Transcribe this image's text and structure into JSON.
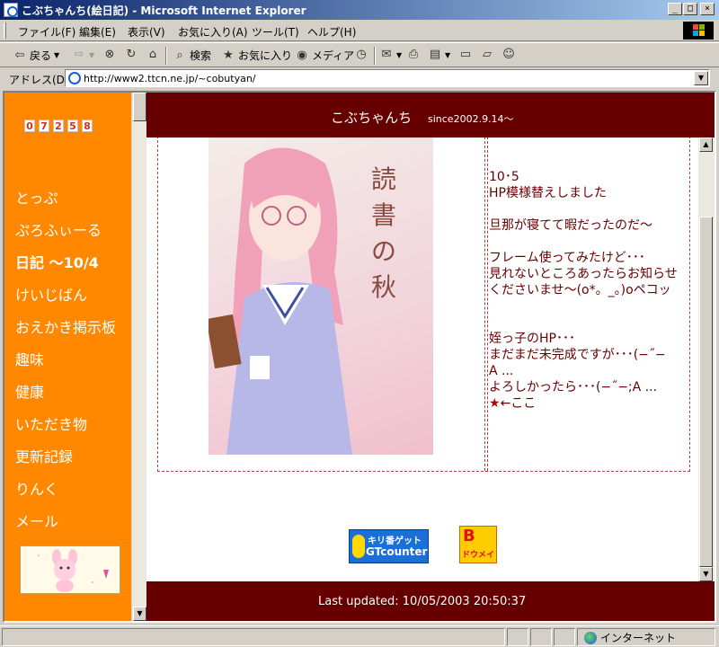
{
  "window": {
    "title": "こぶちゃんち(絵日記) - Microsoft Internet Explorer",
    "min_glyph": "_",
    "max_glyph": "□",
    "close_glyph": "×"
  },
  "menu": [
    "ファイル(F)",
    "編集(E)",
    "表示(V)",
    "お気に入り(A)",
    "ツール(T)",
    "ヘルプ(H)"
  ],
  "toolbar": {
    "back": "戻る",
    "search": "検索",
    "favorites": "お気に入り",
    "media": "メディア"
  },
  "address": {
    "label": "アドレス(D)",
    "url": "http://www2.ttcn.ne.jp/~cobutyan/"
  },
  "sidebar": {
    "counter_digits": [
      "0",
      "7",
      "2",
      "5",
      "8"
    ],
    "links": [
      "とっぷ",
      "ぷろふぃーる",
      "日記 〜10/4",
      "けいじばん",
      "おえかき掲示板",
      "趣味",
      "健康",
      "いただき物",
      "更新記録",
      "りんく",
      "メール"
    ]
  },
  "header": {
    "site_name": "こぶちゃんち",
    "since": "since2002.9.14〜"
  },
  "artwork": {
    "caption_line1": "読書の",
    "caption_line2": "秋"
  },
  "news": {
    "lines": [
      "10･5",
      "HP模様替えしました",
      "",
      "旦那が寝てて暇だったのだ〜",
      "",
      "フレーム使ってみたけど･･･",
      "見れないところあったらお知らせ",
      "くださいませ〜(o*。_。)oペコッ",
      "",
      "",
      "姪っ子のHP･･･",
      "まだまだ未完成ですが･･･(−˝−",
      "A ...",
      "よろしかったら･･･(−˝−;A ..."
    ],
    "star": "★",
    "link_text": "←ここ"
  },
  "banners": {
    "gt_line1": "キリ番ゲット",
    "gt_line2": "GTcounter",
    "bdoumei_b": "B",
    "bdoumei_text": "ドウメイ"
  },
  "footer": {
    "last_updated": "Last updated: 10/05/2003 20:50:37"
  },
  "status": {
    "zone": "インターネット"
  },
  "colors": {
    "sidebar": "#ff8800",
    "band": "#660000",
    "text": "#660000"
  }
}
